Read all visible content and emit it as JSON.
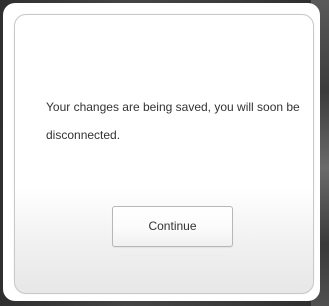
{
  "dialog": {
    "message": "Your changes are being saved, you will soon be disconnected.",
    "continue_label": "Continue"
  },
  "colors": {
    "dialog_background": "#ffffff",
    "dialog_border": "#c9c9c9",
    "text": "#333333",
    "backdrop": "#3a3a3a"
  }
}
